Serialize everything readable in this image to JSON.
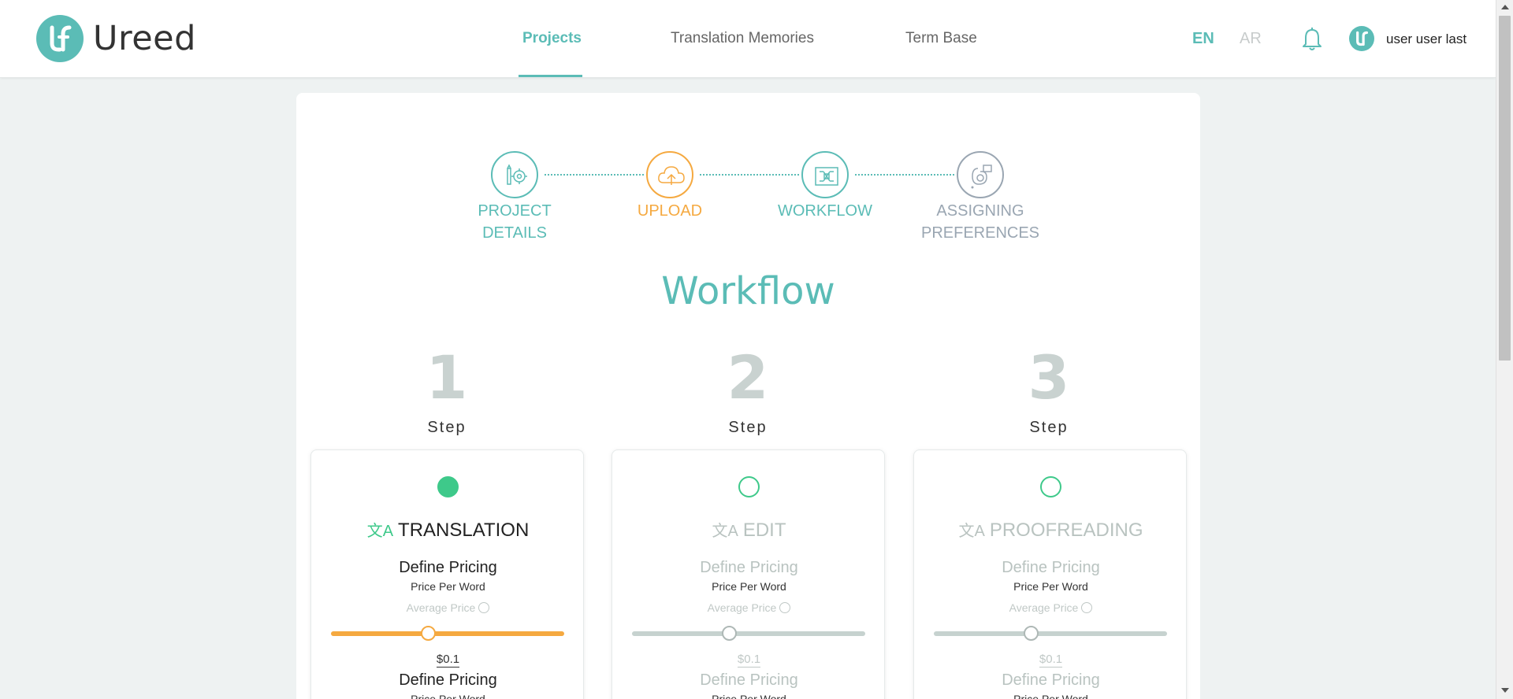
{
  "brand": {
    "name": "Ureed"
  },
  "nav": {
    "items": [
      {
        "label": "Projects",
        "active": true
      },
      {
        "label": "Translation Memories",
        "active": false
      },
      {
        "label": "Term Base",
        "active": false
      }
    ]
  },
  "lang": {
    "en": "EN",
    "ar": "AR",
    "active": "EN"
  },
  "user": {
    "name": "user user last"
  },
  "stepper": [
    {
      "label": "PROJECT DETAILS",
      "state": "done"
    },
    {
      "label": "UPLOAD",
      "state": "current"
    },
    {
      "label": "WORKFLOW",
      "state": "done"
    },
    {
      "label": "ASSIGNING PREFERENCES",
      "state": "pending"
    }
  ],
  "workflow": {
    "title": "Workflow",
    "steps": [
      {
        "number": "1",
        "word": "Step",
        "title": "TRANSLATION",
        "selected": true,
        "define_pricing": "Define Pricing",
        "price_per_word": "Price Per Word",
        "average_price": "Average Price",
        "slider_value": 0.42,
        "price": "$0.1",
        "define_pricing_2": "Define Pricing",
        "price_per_word_2": "Price Per Word"
      },
      {
        "number": "2",
        "word": "Step",
        "title": "EDIT",
        "selected": false,
        "define_pricing": "Define Pricing",
        "price_per_word": "Price Per Word",
        "average_price": "Average Price",
        "slider_value": 0.42,
        "price": "$0.1",
        "define_pricing_2": "Define Pricing",
        "price_per_word_2": "Price Per Word"
      },
      {
        "number": "3",
        "word": "Step",
        "title": "PROOFREADING",
        "selected": false,
        "define_pricing": "Define Pricing",
        "price_per_word": "Price Per Word",
        "average_price": "Average Price",
        "slider_value": 0.42,
        "price": "$0.1",
        "define_pricing_2": "Define Pricing",
        "price_per_word_2": "Price Per Word"
      }
    ]
  },
  "colors": {
    "accent": "#5bbcb6",
    "orange": "#f5a940",
    "green": "#3ec98a",
    "muted": "#9aa6b2"
  },
  "icons": {
    "stepper": [
      "project-details-icon",
      "upload-cloud-icon",
      "workflow-icon",
      "assigning-preferences-icon"
    ],
    "bell": "bell-icon",
    "translate": "translate-icon"
  }
}
